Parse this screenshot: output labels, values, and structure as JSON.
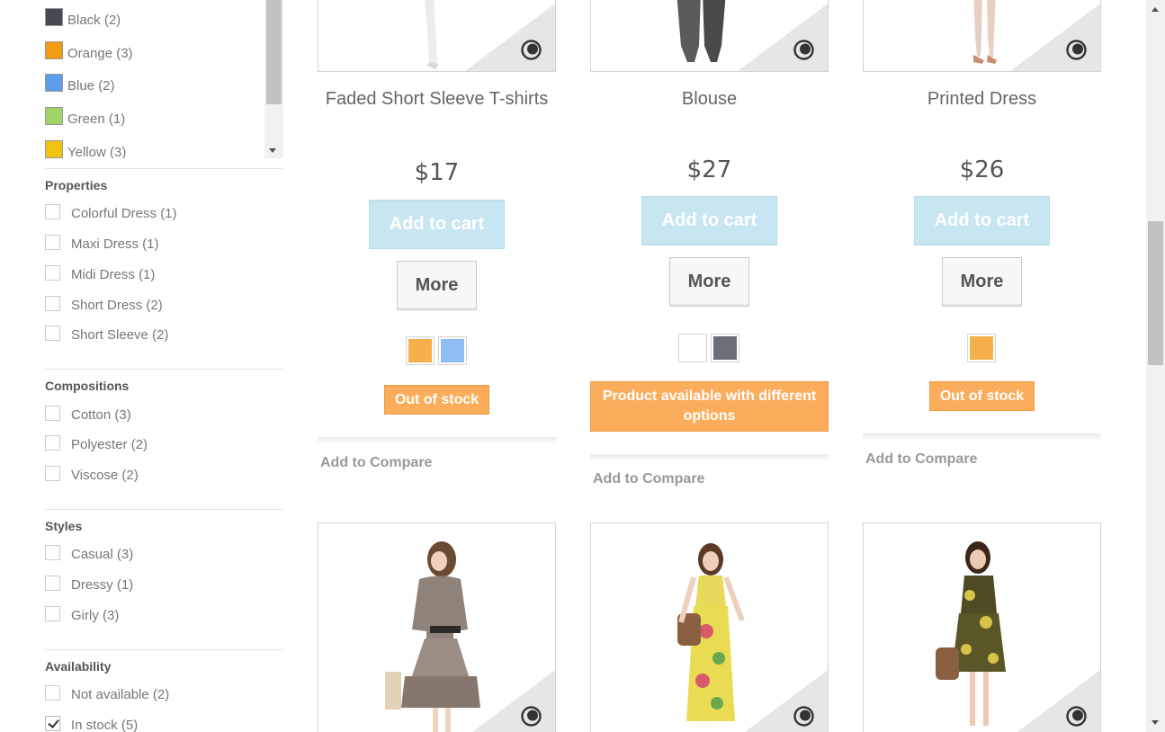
{
  "sidebar": {
    "colors": [
      {
        "label": "Black (2)",
        "color": "#434a54"
      },
      {
        "label": "Orange (3)",
        "color": "#f39c11"
      },
      {
        "label": "Blue (2)",
        "color": "#5d9cec"
      },
      {
        "label": "Green (1)",
        "color": "#a0d468"
      },
      {
        "label": "Yellow (3)",
        "color": "#f1c40f"
      }
    ],
    "properties": {
      "title": "Properties",
      "items": [
        "Colorful Dress (1)",
        "Maxi Dress (1)",
        "Midi Dress (1)",
        "Short Dress (2)",
        "Short Sleeve (2)"
      ]
    },
    "compositions": {
      "title": "Compositions",
      "items": [
        "Cotton (3)",
        "Polyester (2)",
        "Viscose (2)"
      ]
    },
    "styles": {
      "title": "Styles",
      "items": [
        "Casual (3)",
        "Dressy (1)",
        "Girly (3)"
      ]
    },
    "availability": {
      "title": "Availability",
      "items": [
        "Not available (2)",
        "In stock (5)"
      ],
      "checked": [
        false,
        true
      ]
    }
  },
  "products": [
    {
      "name": "Faded Short Sleeve T-shirts",
      "price": "$17",
      "add_to_cart": "Add to cart",
      "more": "More",
      "swatches": [
        "#f5b04c",
        "#8fbef5"
      ],
      "stock": "Out of stock",
      "compare": "Add to Compare"
    },
    {
      "name": "Blouse",
      "price": "$27",
      "add_to_cart": "Add to cart",
      "more": "More",
      "swatches": [
        "#ffffff",
        "#6b6f76"
      ],
      "stock": "Product available with different options",
      "compare": "Add to Compare"
    },
    {
      "name": "Printed Dress",
      "price": "$26",
      "add_to_cart": "Add to cart",
      "more": "More",
      "swatches": [
        "#f5b04c"
      ],
      "stock": "Out of stock",
      "compare": "Add to Compare"
    }
  ],
  "icons": {
    "quick_view": "eye-icon",
    "checkmark": "checkmark-icon"
  },
  "colors": {
    "cart_button": "#c7e6f2",
    "stock_badge": "#fcad5c",
    "card_border": "#d6d4d4"
  }
}
